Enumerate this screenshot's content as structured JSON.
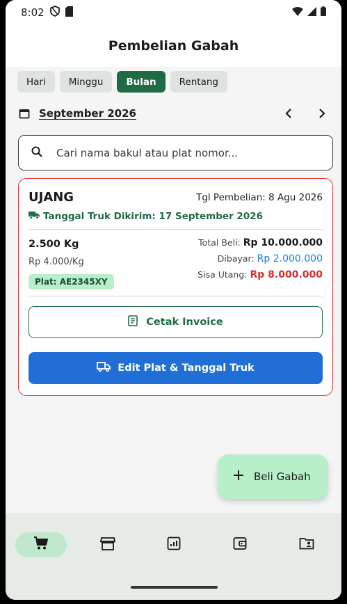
{
  "status_bar": {
    "time": "8:02"
  },
  "app_bar": {
    "title": "Pembelian Gabah"
  },
  "filters": [
    {
      "label": "Hari",
      "active": false
    },
    {
      "label": "Minggu",
      "active": false
    },
    {
      "label": "Bulan",
      "active": true
    },
    {
      "label": "Rentang",
      "active": false
    }
  ],
  "period": {
    "label": "September 2026"
  },
  "search": {
    "placeholder": "Cari nama bakul atau plat nomor..."
  },
  "purchase": {
    "name": "UJANG",
    "purchase_date": "Tgl Pembelian: 8 Agu 2026",
    "truck_sent": "Tanggal Truk Dikirim: 17 September 2026",
    "quantity": "2.500 Kg",
    "unit_price": "Rp 4.000/Kg",
    "plate": "Plat: AE2345XY",
    "total_label": "Total Beli:",
    "total_value": "Rp 10.000.000",
    "paid_label": "Dibayar:",
    "paid_value": "Rp 2.000.000",
    "debt_label": "Sisa Utang:",
    "debt_value": "Rp 8.000.000",
    "print_label": "Cetak Invoice",
    "edit_label": "Edit Plat & Tanggal Truk"
  },
  "fab": {
    "label": "Beli Gabah"
  },
  "bottom_nav": [
    {
      "icon": "cart-icon",
      "active": true
    },
    {
      "icon": "store-icon",
      "active": false
    },
    {
      "icon": "report-icon",
      "active": false
    },
    {
      "icon": "wallet-icon",
      "active": false
    },
    {
      "icon": "contact-folder-icon",
      "active": false
    }
  ],
  "colors": {
    "primary_green": "#1f6b45",
    "accent_blue": "#1f6fd6",
    "debt_red": "#d32f2f",
    "paid_blue": "#1e7be0",
    "light_green": "#b7efc9"
  }
}
